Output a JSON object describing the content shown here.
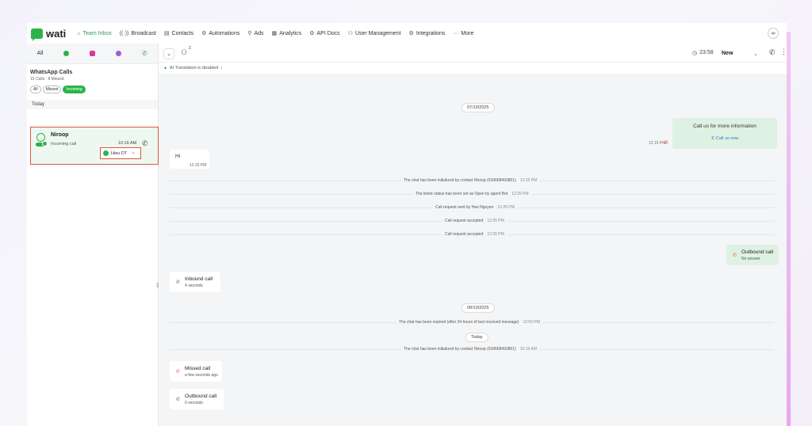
{
  "nav": {
    "logo": "wati",
    "items": [
      {
        "label": "Team Inbox",
        "icon": "inbox-icon",
        "glyph": "⌂",
        "active": true
      },
      {
        "label": "Broadcast",
        "icon": "broadcast-icon",
        "glyph": "((·))"
      },
      {
        "label": "Contacts",
        "icon": "contacts-icon",
        "glyph": "▤"
      },
      {
        "label": "Automations",
        "icon": "automations-icon",
        "glyph": "⚙"
      },
      {
        "label": "Ads",
        "icon": "ads-icon",
        "glyph": "⚲"
      },
      {
        "label": "Analytics",
        "icon": "analytics-icon",
        "glyph": "▦"
      },
      {
        "label": "API Docs",
        "icon": "api-docs-icon",
        "glyph": "⚙"
      },
      {
        "label": "User Management",
        "icon": "user-management-icon",
        "glyph": "⚇"
      },
      {
        "label": "Integrations",
        "icon": "integrations-icon",
        "glyph": "⚙"
      },
      {
        "label": "More",
        "icon": "more-icon",
        "glyph": "···"
      }
    ],
    "right_icon": "glasses-icon"
  },
  "left": {
    "tabs": {
      "all": "All"
    },
    "title": "WhatsApp Calls",
    "subtitle": "15 Calls · 8 Missed",
    "filters": [
      {
        "label": "All",
        "active": false
      },
      {
        "label": "Missed",
        "active": false
      },
      {
        "label": "Incoming",
        "active": true
      }
    ],
    "section": "Today",
    "call": {
      "name": "Niroop",
      "type": "Incoming call",
      "time": "10:16 AM",
      "agent": "Hieu DT"
    }
  },
  "toolbar": {
    "assign_count": "2",
    "timer": "23:58",
    "status": "New"
  },
  "translation": "AI Translation is disabled",
  "messages": {
    "date1": "07/10/2025",
    "call_us_text": "Call us for more information",
    "call_us_btn": "Call us now",
    "call_us_time": "12:15 PM",
    "hi_text": "Hi",
    "hi_time": "12:25 PM",
    "sys1": {
      "text": "The chat has been initialized by contact Niroop (918668493801)",
      "time": "12:25 PM"
    },
    "sys2": {
      "text": "The ticket status has been set as Open by agent Bot",
      "time": "12:25 PM"
    },
    "sys3": {
      "text": "Call request sent by Hao Nguyen",
      "time": "12:25 PM"
    },
    "sys4": {
      "text": "Call request accepted",
      "time": "12:25 PM"
    },
    "sys5": {
      "text": "Call request accepted",
      "time": "12:26 PM"
    },
    "outbound1": {
      "title": "Outbound call",
      "sub": "No answer"
    },
    "inbound1": {
      "title": "Inbound call",
      "sub": "4 seconds"
    },
    "date2": "08/10/2025",
    "sys6": {
      "text": "The chat has been expired (after 24 hours of last received message)",
      "time": "12:50 PM"
    },
    "date3": "Today",
    "sys7": {
      "text": "The chat has been initialized by contact Niroop (918668493801)",
      "time": "10:16 AM"
    },
    "missed1": {
      "title": "Missed call",
      "sub": "a few seconds ago"
    },
    "outbound2": {
      "title": "Outbound call",
      "sub": "0 seconds"
    }
  }
}
